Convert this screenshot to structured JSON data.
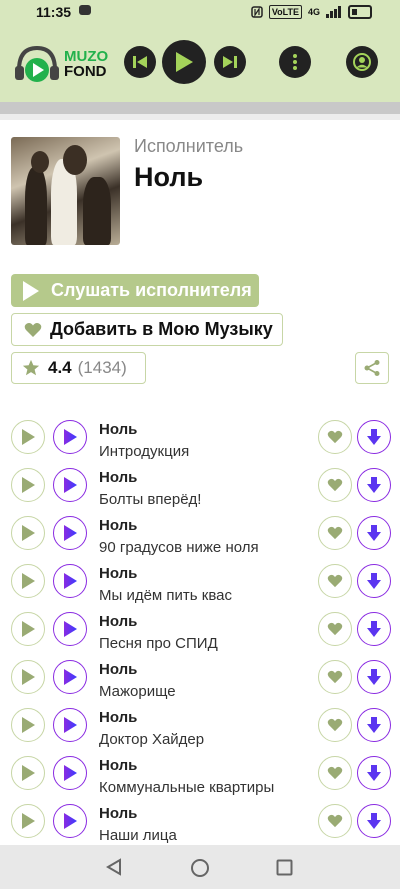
{
  "status_bar": {
    "time": "11:35",
    "volte": "VoLTE",
    "network": "4G"
  },
  "header": {
    "logo_line1": "MUZO",
    "logo_line2": "FOND",
    "accent_color": "#22b14c",
    "header_bg": "#d8e7be"
  },
  "artist": {
    "label": "Исполнитель",
    "name": "Ноль"
  },
  "actions": {
    "listen_label": "Слушать исполнителя",
    "add_label": "Добавить в Мою Музыку",
    "rating_value": "4.4",
    "rating_count": "(1434)"
  },
  "tracks": [
    {
      "artist": "Ноль",
      "title": "Интродукция"
    },
    {
      "artist": "Ноль",
      "title": "Болты вперёд!"
    },
    {
      "artist": "Ноль",
      "title": "90 градусов ниже ноля"
    },
    {
      "artist": "Ноль",
      "title": "Мы идём пить квас"
    },
    {
      "artist": "Ноль",
      "title": "Песня про СПИД"
    },
    {
      "artist": "Ноль",
      "title": "Мажорище"
    },
    {
      "artist": "Ноль",
      "title": "Доктор Хайдер"
    },
    {
      "artist": "Ноль",
      "title": "Коммунальные квартиры"
    },
    {
      "artist": "Ноль",
      "title": "Наши лица"
    }
  ],
  "colors": {
    "olive": "#9aab74",
    "purple": "#8a2be2",
    "blue": "#3b3bff"
  },
  "icons": {
    "nav_back": "back-triangle-icon",
    "nav_home": "home-circle-icon",
    "nav_recents": "recents-square-icon"
  }
}
